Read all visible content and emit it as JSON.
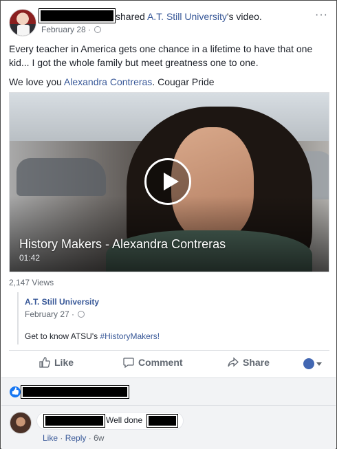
{
  "post": {
    "action_text": "shared",
    "page_name": "A.T. Still University",
    "page_suffix": "'s video.",
    "date": "February 28",
    "separator": "·",
    "more": "···",
    "body_line1": "Every teacher in America gets one chance in a lifetime to have that one kid... I got the whole family but meet greatness one to one.",
    "body_line2_prefix": "We love you ",
    "body_line2_mention": "Alexandra Contreras",
    "body_line2_suffix": ". Cougar Pride"
  },
  "video": {
    "title": "History Makers - Alexandra Contreras",
    "duration": "01:42",
    "views": "2,147 Views"
  },
  "shared_post": {
    "author": "A.T. Still University",
    "date": "February 27",
    "separator": "·",
    "text_prefix": "Get to know ATSU's ",
    "hashtag": "#HistoryMakers!"
  },
  "actions": {
    "like": "Like",
    "comment": "Comment",
    "share": "Share"
  },
  "comment": {
    "text": "Well done",
    "like": "Like",
    "separator": "·",
    "reply": "Reply",
    "age": "6w"
  },
  "colors": {
    "link": "#385898",
    "muted": "#606770",
    "like_blue": "#1877f2",
    "panel_bg": "#f2f3f5"
  }
}
